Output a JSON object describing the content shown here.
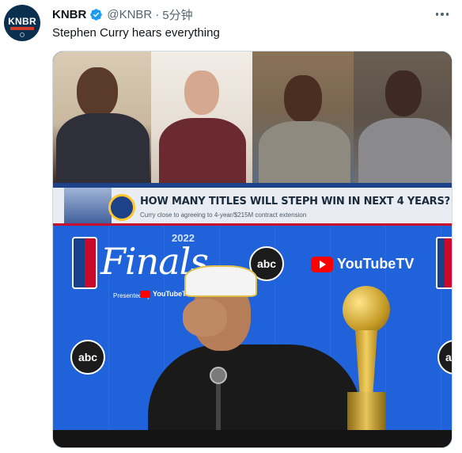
{
  "tweet": {
    "author_name": "KNBR",
    "handle": "@KNBR",
    "separator": "·",
    "time": "5分钟",
    "text": "Stephen Curry hears everything",
    "avatar_text": "KNBR"
  },
  "media": {
    "banner_headline": "HOW MANY TITLES WILL STEPH WIN IN NEXT 4 YEARS?",
    "banner_subtext": "Curry close to agreeing to 4-year/$215M contract extension",
    "finals_text": "Finals",
    "finals_year": "2022",
    "presented_by": "Presented by",
    "youtube_tv_label": "YouTubeTV",
    "youtube_small_label": "YouTubeTV",
    "abc_label": "abc"
  },
  "colors": {
    "verified_badge": "#1d9bf0",
    "secondary_text": "#536471",
    "primary_text": "#0f1419",
    "avatar_bg": "#0b2f4f"
  },
  "icons": {
    "verified": "verified-badge-icon",
    "more": "more-options-icon"
  }
}
